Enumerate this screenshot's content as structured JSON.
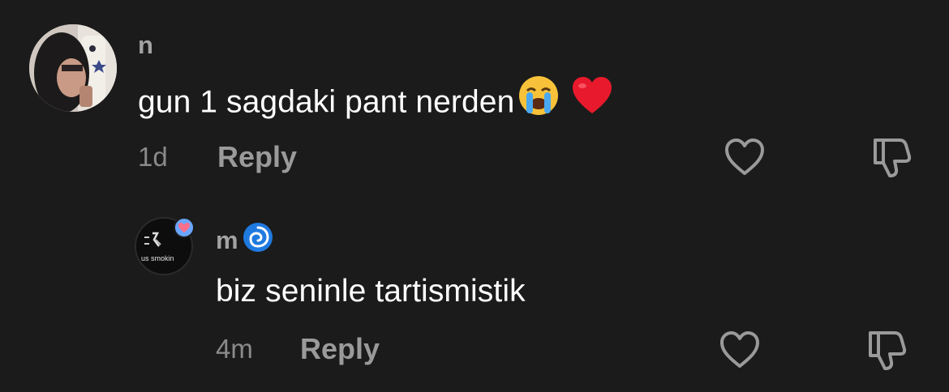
{
  "comments": [
    {
      "username": "n",
      "text": "gun 1 sagdaki pant nerden",
      "emojis": [
        "crying-face-emoji",
        "red-heart-emoji"
      ],
      "time": "1d",
      "reply_label": "Reply",
      "avatar": "user-photo"
    },
    {
      "username": "m",
      "username_emoji": "cyclone-emoji",
      "text": "biz seninle tartismistik",
      "time": "4m",
      "reply_label": "Reply",
      "avatar": "video-thumbnail",
      "avatar_caption": "us smokin"
    }
  ],
  "icons": {
    "like": "heart-outline-icon",
    "dislike": "thumbs-down-outline-icon"
  },
  "colors": {
    "background": "#1b1b1b",
    "text": "#ffffff",
    "muted": "#9a9a9a",
    "heart_emoji": "#e8192c",
    "cyclone_emoji": "#1f7ae0"
  }
}
